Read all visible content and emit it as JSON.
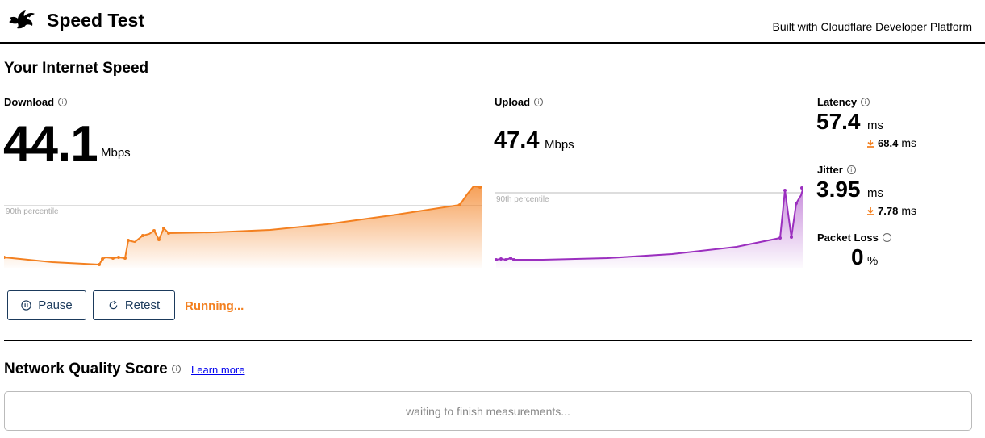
{
  "header": {
    "title": "Speed Test",
    "built_with": "Built with Cloudflare Developer Platform"
  },
  "speed_section": {
    "title": "Your Internet Speed"
  },
  "download": {
    "label": "Download",
    "value": "44.1",
    "unit": "Mbps",
    "percentile_label": "90th percentile",
    "color": "#f38020"
  },
  "upload": {
    "label": "Upload",
    "value": "47.4",
    "unit": "Mbps",
    "percentile_label": "90th percentile",
    "color": "#9b2fbf"
  },
  "latency": {
    "label": "Latency",
    "value": "57.4",
    "unit": "ms",
    "loaded_value": "68.4",
    "loaded_unit": "ms"
  },
  "jitter": {
    "label": "Jitter",
    "value": "3.95",
    "unit": "ms",
    "loaded_value": "7.78",
    "loaded_unit": "ms"
  },
  "packet_loss": {
    "label": "Packet Loss",
    "value": "0",
    "unit": "%"
  },
  "controls": {
    "pause_label": "Pause",
    "retest_label": "Retest",
    "status": "Running..."
  },
  "network_quality": {
    "title": "Network Quality Score",
    "learn_more": "Learn more",
    "waiting_text": "waiting to finish measurements..."
  },
  "icons": {
    "logo": "rabbit-logo-icon",
    "info": "info-icon",
    "pause": "pause-icon",
    "retest": "refresh-icon",
    "loaded": "download-arrow-icon"
  }
}
